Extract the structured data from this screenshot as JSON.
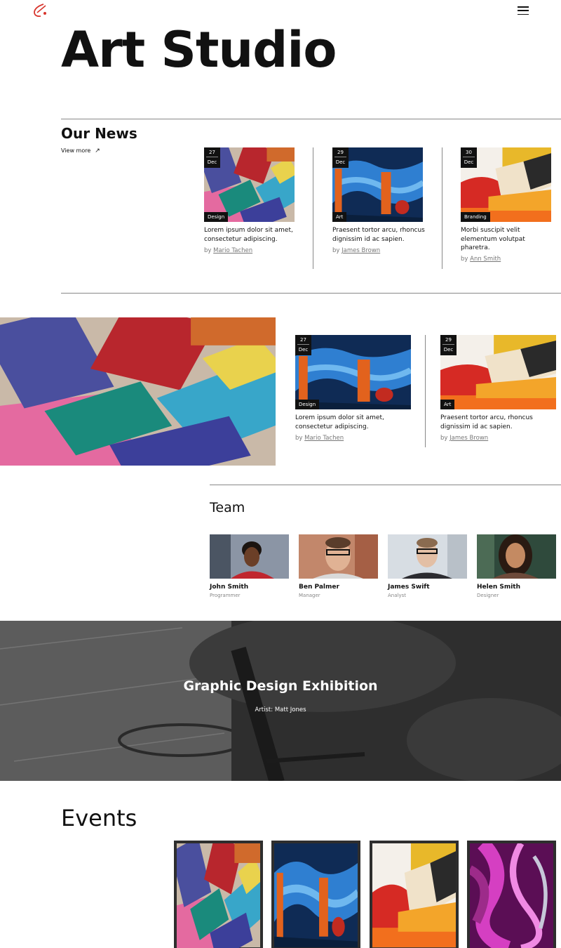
{
  "site": {
    "title": "Art Studio",
    "logo_icon": "brush-stroke-logo-icon",
    "menu_icon": "hamburger-menu-icon"
  },
  "news": {
    "heading": "Our News",
    "view_more": "View more",
    "view_more_icon": "arrow-up-right-icon",
    "cards": [
      {
        "day": "27",
        "month": "Dec",
        "tag": "Design",
        "excerpt": "Lorem ipsum dolor sit amet, consectetur adipiscing.",
        "by": "by",
        "author": "Mario Tachen"
      },
      {
        "day": "29",
        "month": "Dec",
        "tag": "Art",
        "excerpt": "Praesent tortor arcu, rhoncus dignissim id ac sapien.",
        "by": "by",
        "author": "James Brown"
      },
      {
        "day": "30",
        "month": "Dec",
        "tag": "Branding",
        "excerpt": "Morbi suscipit velit elementum volutpat pharetra.",
        "by": "by",
        "author": "Ann Smith"
      }
    ],
    "cards2": [
      {
        "day": "27",
        "month": "Dec",
        "tag": "Design",
        "excerpt": "Lorem ipsum dolor sit amet, consectetur adipiscing.",
        "by": "by",
        "author": "Mario Tachen"
      },
      {
        "day": "29",
        "month": "Dec",
        "tag": "Art",
        "excerpt": "Praesent tortor arcu, rhoncus dignissim id ac sapien.",
        "by": "by",
        "author": "James Brown"
      }
    ]
  },
  "team": {
    "heading": "Team",
    "members": [
      {
        "name": "John Smith",
        "role": "Programmer"
      },
      {
        "name": "Ben Palmer",
        "role": "Manager"
      },
      {
        "name": "James Swift",
        "role": "Analyst"
      },
      {
        "name": "Helen Smith",
        "role": "Designer"
      }
    ]
  },
  "exhibition": {
    "title": "Graphic Design Exhibition",
    "artist": "Artist: Matt Jones"
  },
  "events": {
    "heading": "Events"
  },
  "colors": {
    "accent_logo": "#d8342c",
    "dark": "#111111",
    "banner": "#3a3a3a"
  }
}
